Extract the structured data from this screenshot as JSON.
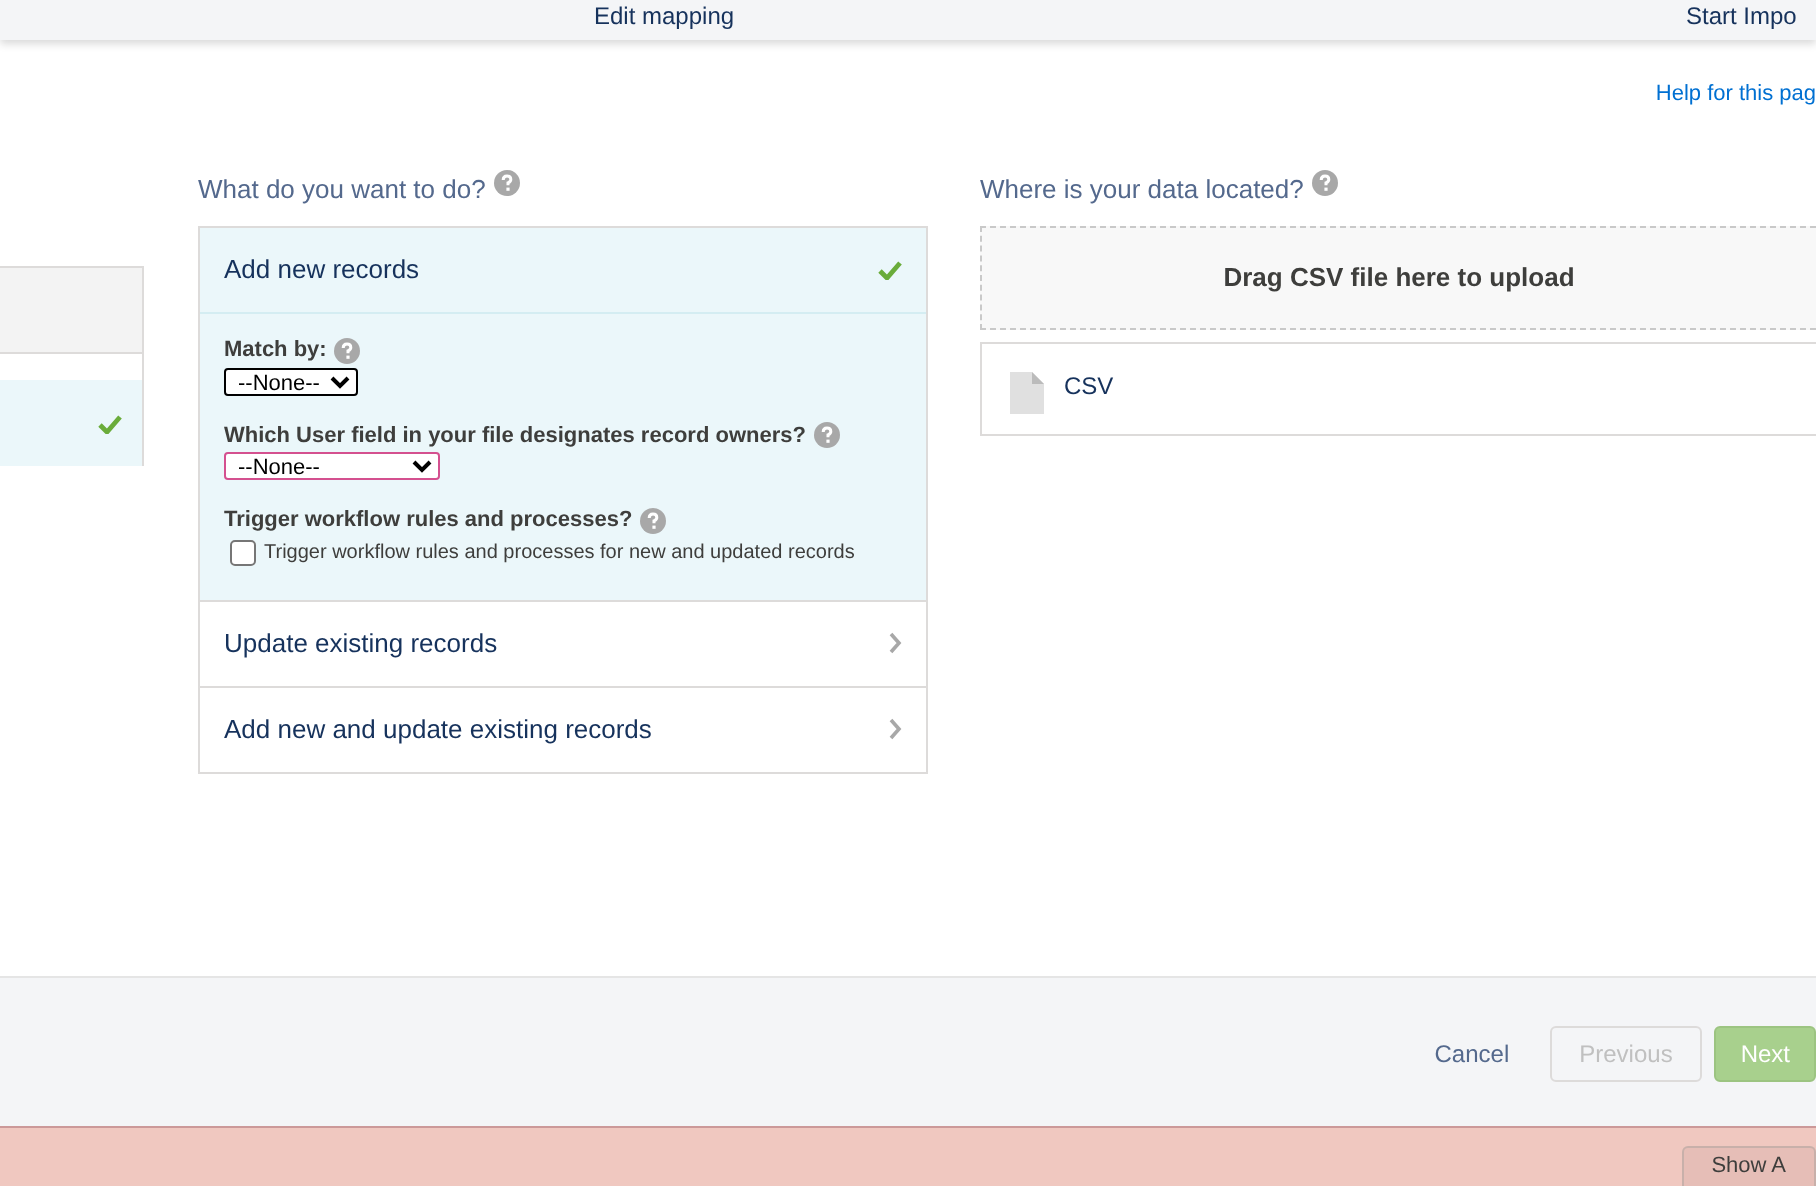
{
  "steps": [
    {
      "label": "Edit mapping"
    },
    {
      "label": "Start Impo"
    }
  ],
  "help_link": "Help for this pag",
  "left_panel": {
    "items": [
      {
        "selected": false
      },
      {
        "selected": true
      }
    ]
  },
  "action": {
    "title": "What do you want to do?",
    "options": [
      {
        "label": "Add new records",
        "selected": true,
        "expanded": true
      },
      {
        "label": "Update existing records",
        "selected": false,
        "expanded": false
      },
      {
        "label": "Add new and update existing records",
        "selected": false,
        "expanded": false
      }
    ],
    "details": {
      "match_by_label": "Match by:",
      "match_by_value": "--None--",
      "owner_label": "Which User field in your file designates record owners?",
      "owner_value": "--None--",
      "trigger_label": "Trigger workflow rules and processes?",
      "trigger_checkbox": {
        "label": "Trigger workflow rules and processes for new and updated records",
        "checked": false
      }
    }
  },
  "source": {
    "title": "Where is your data located?",
    "drop_zone": "Drag CSV file here to upload",
    "files": [
      {
        "label": "CSV"
      }
    ]
  },
  "footer": {
    "buttons": [
      {
        "label": "Cancel",
        "kind": "link",
        "disabled": false
      },
      {
        "label": "Previous",
        "kind": "secondary",
        "disabled": true
      },
      {
        "label": "Next",
        "kind": "primary",
        "disabled": false
      }
    ]
  },
  "banner": {
    "button": "Show A"
  }
}
